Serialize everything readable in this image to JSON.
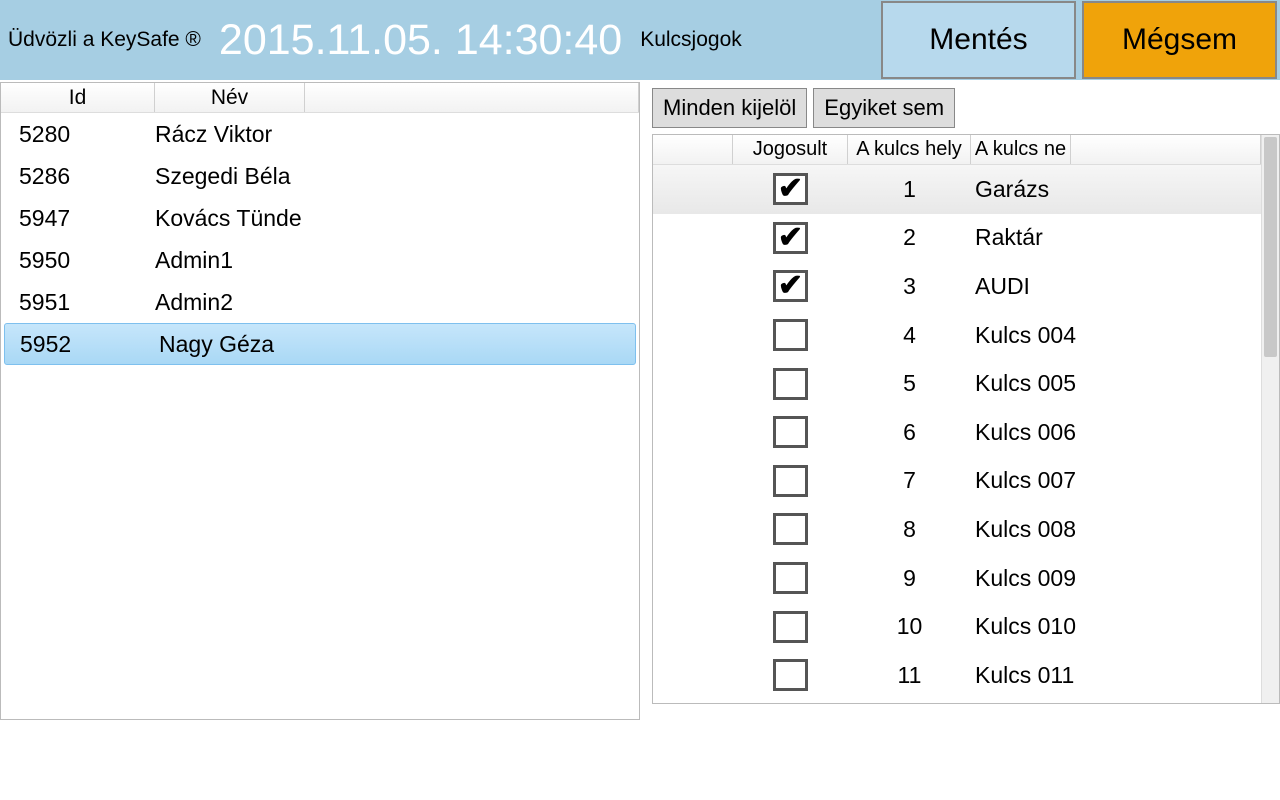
{
  "header": {
    "welcome": "Üdvözli a KeySafe ®",
    "timestamp": "2015.11.05. 14:30:40",
    "section": "Kulcsjogok",
    "save_label": "Mentés",
    "cancel_label": "Mégsem"
  },
  "users": {
    "columns": {
      "id": "Id",
      "name": "Név"
    },
    "rows": [
      {
        "id": "5280",
        "name": "Rácz Viktor",
        "selected": false
      },
      {
        "id": "5286",
        "name": "Szegedi Béla",
        "selected": false
      },
      {
        "id": "5947",
        "name": "Kovács Tünde",
        "selected": false
      },
      {
        "id": "5950",
        "name": "Admin1",
        "selected": false
      },
      {
        "id": "5951",
        "name": "Admin2",
        "selected": false
      },
      {
        "id": "5952",
        "name": "Nagy Géza",
        "selected": true
      }
    ]
  },
  "toolbar": {
    "select_all": "Minden kijelöl",
    "select_none": "Egyiket sem"
  },
  "keys": {
    "columns": {
      "authorized": "Jogosult",
      "position": "A kulcs hely",
      "name": "A kulcs ne"
    },
    "rows": [
      {
        "authorized": true,
        "position": "1",
        "name": "Garázs",
        "highlight": true
      },
      {
        "authorized": true,
        "position": "2",
        "name": "Raktár",
        "highlight": false
      },
      {
        "authorized": true,
        "position": "3",
        "name": "AUDI",
        "highlight": false
      },
      {
        "authorized": false,
        "position": "4",
        "name": "Kulcs 004",
        "highlight": false
      },
      {
        "authorized": false,
        "position": "5",
        "name": "Kulcs 005",
        "highlight": false
      },
      {
        "authorized": false,
        "position": "6",
        "name": "Kulcs 006",
        "highlight": false
      },
      {
        "authorized": false,
        "position": "7",
        "name": "Kulcs 007",
        "highlight": false
      },
      {
        "authorized": false,
        "position": "8",
        "name": "Kulcs 008",
        "highlight": false
      },
      {
        "authorized": false,
        "position": "9",
        "name": "Kulcs 009",
        "highlight": false
      },
      {
        "authorized": false,
        "position": "10",
        "name": "Kulcs 010",
        "highlight": false
      },
      {
        "authorized": false,
        "position": "11",
        "name": "Kulcs 011",
        "highlight": false
      }
    ]
  }
}
